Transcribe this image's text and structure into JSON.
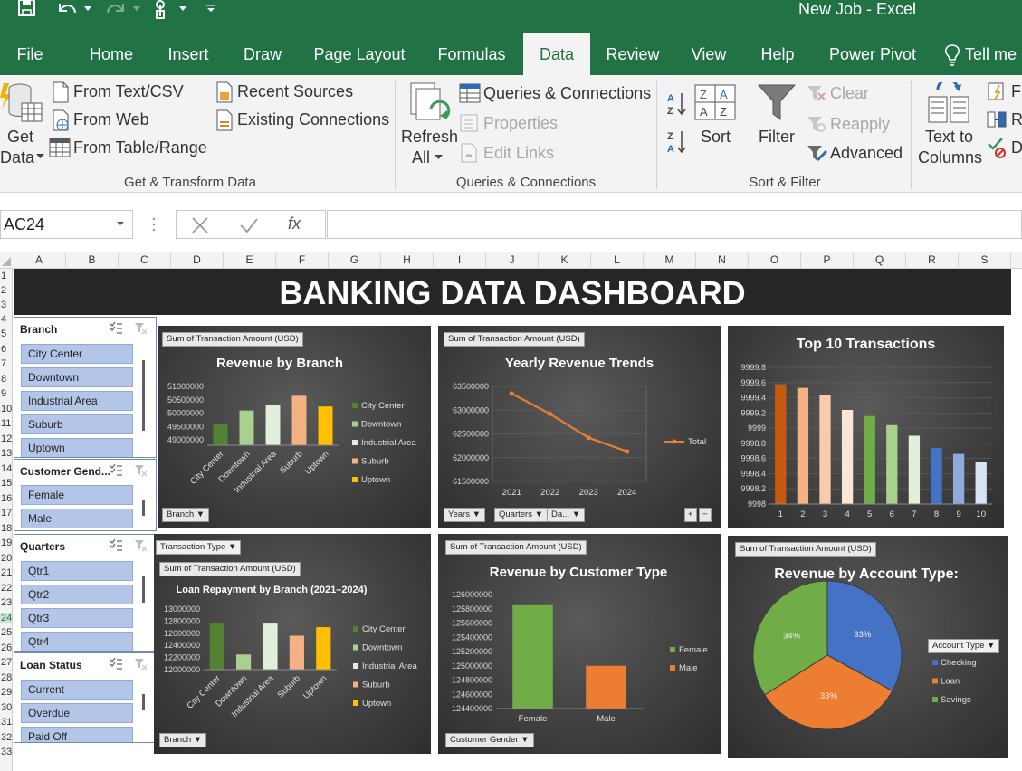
{
  "window": {
    "title": "New Job  -  Excel"
  },
  "tabs": [
    "File",
    "Home",
    "Insert",
    "Draw",
    "Page Layout",
    "Formulas",
    "Data",
    "Review",
    "View",
    "Help",
    "Power Pivot"
  ],
  "tell_me": "Tell me",
  "ribbon": {
    "get_data": {
      "line1": "Get",
      "line2": "Data"
    },
    "from_text_csv": "From Text/CSV",
    "from_web": "From Web",
    "from_table_range": "From Table/Range",
    "recent_sources": "Recent Sources",
    "existing_connections": "Existing Connections",
    "group_get_transform": "Get & Transform Data",
    "refresh_all": {
      "line1": "Refresh",
      "line2": "All"
    },
    "queries_connections": "Queries & Connections",
    "properties": "Properties",
    "edit_links": "Edit Links",
    "group_queries": "Queries & Connections",
    "sort": "Sort",
    "filter": "Filter",
    "clear": "Clear",
    "reapply": "Reapply",
    "advanced": "Advanced",
    "group_sort_filter": "Sort & Filter",
    "text_to_columns": {
      "line1": "Text to",
      "line2": "Columns"
    },
    "fl": "Fl",
    "re": "Re",
    "d": "D"
  },
  "formula_bar": {
    "name_box": "AC24",
    "formula": ""
  },
  "columns": [
    "A",
    "B",
    "C",
    "D",
    "E",
    "F",
    "G",
    "H",
    "I",
    "J",
    "K",
    "L",
    "M",
    "N",
    "O",
    "P",
    "Q",
    "R",
    "S"
  ],
  "rows": [
    "1",
    "2",
    "3",
    "4",
    "5",
    "6",
    "7",
    "8",
    "9",
    "10",
    "11",
    "12",
    "13",
    "14",
    "15",
    "16",
    "17",
    "18",
    "19",
    "20",
    "21",
    "22",
    "23",
    "24",
    "25",
    "26",
    "27",
    "28",
    "29",
    "30",
    "31",
    "32",
    "33"
  ],
  "dashboard_title": "BANKING DATA DASHBOARD",
  "slicers": {
    "branch": {
      "title": "Branch",
      "items": [
        "City Center",
        "Downtown",
        "Industrial Area",
        "Suburb",
        "Uptown"
      ]
    },
    "gender": {
      "title": "Customer Gend...",
      "items": [
        "Female",
        "Male"
      ]
    },
    "quarters": {
      "title": "Quarters",
      "items": [
        "Qtr1",
        "Qtr2",
        "Qtr3",
        "Qtr4"
      ]
    },
    "loan": {
      "title": "Loan Status",
      "items": [
        "Current",
        "Overdue",
        "Paid Off"
      ]
    }
  },
  "charts": {
    "revenue_branch": {
      "field": "Sum of Transaction  Amount (USD)",
      "title": "Revenue by Branch",
      "axis_button": "Branch"
    },
    "yearly": {
      "field": "Sum of Transaction  Amount (USD)",
      "title": "Yearly Revenue Trends",
      "btn_years": "Years",
      "btn_quarters": "Quarters",
      "btn_da": "Da..."
    },
    "top10": {
      "title": "Top 10 Transactions"
    },
    "loan": {
      "filter_field": "Transaction Type",
      "field": "Sum of Transaction  Amount (USD)",
      "title": "Loan Repayment by Branch (2021–2024)",
      "axis_button": "Branch"
    },
    "customer": {
      "field": "Sum of Transaction  Amount (USD)",
      "title": "Revenue by Customer Type",
      "axis_button": "Customer Gender"
    },
    "account": {
      "field": "Sum of Transaction  Amount (USD)",
      "title": "Revenue by Account Type:",
      "legend_button": "Account Type"
    }
  },
  "chart_data": [
    {
      "type": "bar",
      "title": "Revenue by Branch",
      "categories": [
        "City Center",
        "Downtown",
        "Industrial Area",
        "Suburb",
        "Uptown"
      ],
      "values": [
        49600000,
        50100000,
        50300000,
        50650000,
        50250000
      ],
      "yticks": [
        49000000,
        49500000,
        50000000,
        50500000,
        51000000
      ],
      "ylim": [
        48800000,
        51000000
      ],
      "colors": [
        "#548235",
        "#a9d08e",
        "#e2efda",
        "#f4b183",
        "#ffc000"
      ]
    },
    {
      "type": "line",
      "title": "Yearly Revenue Trends",
      "categories": [
        "2021",
        "2022",
        "2023",
        "2024"
      ],
      "series": [
        {
          "name": "Total",
          "values": [
            63350000,
            62920000,
            62420000,
            62130000
          ]
        }
      ],
      "yticks": [
        61500000,
        62000000,
        62500000,
        63000000,
        63500000
      ],
      "ylim": [
        61500000,
        63500000
      ]
    },
    {
      "type": "bar",
      "title": "Top 10 Transactions",
      "categories": [
        "1",
        "2",
        "3",
        "4",
        "5",
        "6",
        "7",
        "8",
        "9",
        "10"
      ],
      "values": [
        9999.58,
        9999.53,
        9999.44,
        9999.24,
        9999.16,
        9999.04,
        9998.9,
        9998.74,
        9998.66,
        9998.56
      ],
      "yticks": [
        9998,
        9998.2,
        9998.4,
        9998.6,
        9998.8,
        9999,
        9999.2,
        9999.4,
        9999.6,
        9999.8
      ],
      "ytick_labels": [
        "9998",
        "9998.2",
        "9998.4",
        "9998.6",
        "9998.8",
        "9999",
        "9999.2",
        "9999.4",
        "9999.6",
        "9999.8"
      ],
      "ylim": [
        9998,
        9999.8
      ],
      "colors": [
        "#c55a11",
        "#f4b183",
        "#f8cbad",
        "#fbe5d6",
        "#70ad47",
        "#a9d08e",
        "#e2efda",
        "#4472c4",
        "#8faadc",
        "#dae3f3"
      ]
    },
    {
      "type": "bar",
      "title": "Loan Repayment by Branch (2021–2024)",
      "categories": [
        "City Center",
        "Downtown",
        "Industrial Area",
        "Suburb",
        "Uptown"
      ],
      "values": [
        12760000,
        12250000,
        12760000,
        12560000,
        12700000
      ],
      "yticks": [
        12000000,
        12200000,
        12400000,
        12600000,
        12800000,
        13000000
      ],
      "ylim": [
        12000000,
        13000000
      ],
      "colors": [
        "#548235",
        "#a9d08e",
        "#e2efda",
        "#f4b183",
        "#ffc000"
      ]
    },
    {
      "type": "bar",
      "title": "Revenue by Customer Type",
      "categories": [
        "Female",
        "Male"
      ],
      "series": [
        {
          "name": "Female",
          "values": [
            125850000,
            null
          ]
        },
        {
          "name": "Male",
          "values": [
            null,
            125000000
          ]
        }
      ],
      "values": [
        125850000,
        125000000
      ],
      "yticks": [
        124400000,
        124600000,
        124800000,
        125000000,
        125200000,
        125400000,
        125600000,
        125800000,
        126000000
      ],
      "ylim": [
        124400000,
        126000000
      ],
      "colors": [
        "#70ad47",
        "#ed7d31"
      ]
    },
    {
      "type": "pie",
      "title": "Revenue by Account Type:",
      "categories": [
        "Checking",
        "Loan",
        "Savings"
      ],
      "values": [
        33,
        33,
        34
      ],
      "labels": [
        "33%",
        "33%",
        "34%"
      ],
      "colors": [
        "#4472c4",
        "#ed7d31",
        "#70ad47"
      ]
    }
  ]
}
